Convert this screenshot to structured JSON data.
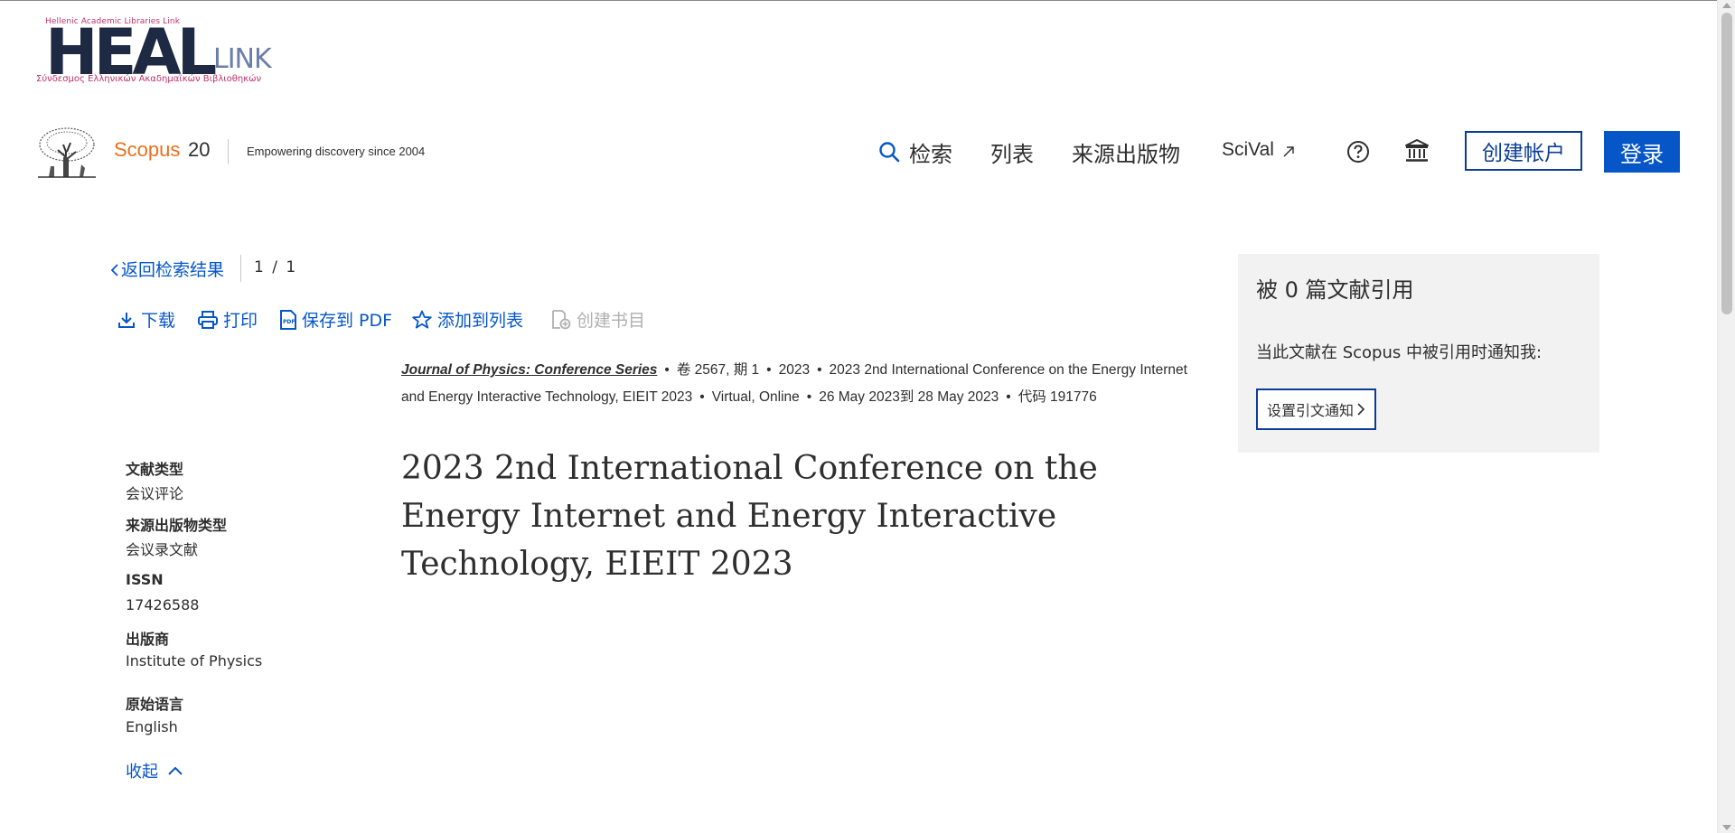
{
  "heallink": {
    "small_text": "Hellenic Academic Libraries Link",
    "big_text": "HEAL",
    "link_text": "LINK",
    "greek_text": "Σύνδεσμος Ελληνικών Ακαδημαϊκών Βιβλιοθηκών"
  },
  "header": {
    "brand": "Scopus",
    "brand_years": "20",
    "tagline": "Empowering discovery since 2004",
    "nav_search": "检索",
    "nav_lists": "列表",
    "nav_sources": "来源出版物",
    "nav_scival": "SciVal",
    "create_account": "创建帐户",
    "login": "登录"
  },
  "back": {
    "label": "返回检索结果",
    "pager": "1 / 1"
  },
  "actions": {
    "download": "下载",
    "print": "打印",
    "save_pdf": "保存到 PDF",
    "add_list": "添加到列表",
    "create_bib": "创建书目"
  },
  "source": {
    "journal": "Journal of Physics: Conference Series",
    "volume_issue": "卷 2567, 期 1",
    "year": "2023",
    "conference": "2023 2nd International Conference on the Energy Internet and Energy Interactive Technology, EIEIT 2023",
    "location": "Virtual, Online",
    "dates": "26 May 2023到 28 May 2023",
    "code": "代码 191776"
  },
  "title": "2023 2nd International Conference on the Energy Internet and Energy Interactive Technology, EIEIT 2023",
  "meta": {
    "doc_type_label": "文献类型",
    "doc_type_value": "会议评论",
    "source_type_label": "来源出版物类型",
    "source_type_value": "会议录文献",
    "issn_label": "ISSN",
    "issn_value": "17426588",
    "publisher_label": "出版商",
    "publisher_value": "Institute of Physics",
    "language_label": "原始语言",
    "language_value": "English",
    "collapse": "收起"
  },
  "cited": {
    "title": "被 0 篇文献引用",
    "notify_text": "当此文献在 Scopus 中被引用时通知我:",
    "button": "设置引文通知"
  }
}
